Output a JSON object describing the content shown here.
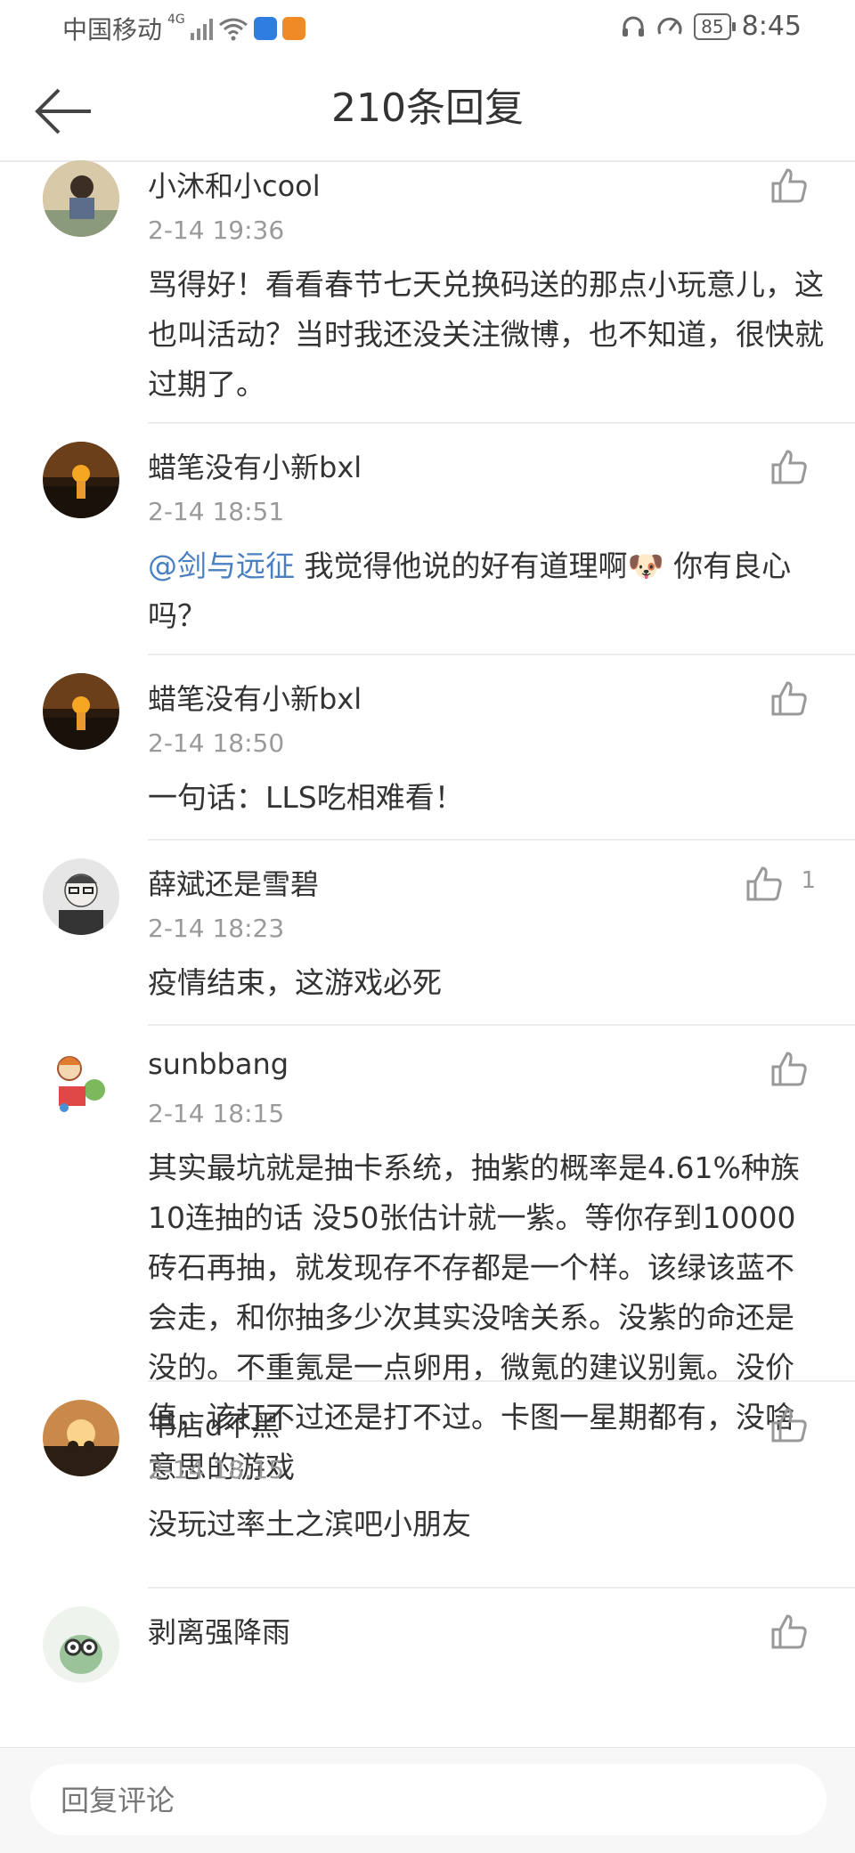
{
  "status_bar": {
    "carrier": "中国移动",
    "network": "4G",
    "battery": "85",
    "time": "8:45"
  },
  "header": {
    "title": "210条回复",
    "back_icon": "arrow-left-icon"
  },
  "comments": [
    {
      "user": "小沐和小cool",
      "time": "2-14 19:36",
      "text": "骂得好！看看春节七天兑换码送的那点小玩意儿，这也叫活动？当时我还没关注微博，也不知道，很快就过期了。",
      "likes": ""
    },
    {
      "user": "蜡笔没有小新bxl",
      "time": "2-14 18:51",
      "mention": "@剑与远征",
      "text": " 我觉得他说的好有道理啊",
      "emoji": "🐶",
      "text2": "  你有良心吗？",
      "likes": ""
    },
    {
      "user": "蜡笔没有小新bxl",
      "time": "2-14 18:50",
      "text": "一句话：LLS吃相难看！",
      "likes": ""
    },
    {
      "user": "薛斌还是雪碧",
      "time": "2-14 18:23",
      "text": "疫情结束，这游戏必死",
      "likes": "1"
    },
    {
      "user": "sunbbang",
      "time": "2-14 18:15",
      "text": "其实最坑就是抽卡系统，抽紫的概率是4.61%种族10连抽的话 没50张估计就一紫。等你存到10000砖石再抽，就发现存不存都是一个样。该绿该蓝不会走，和你抽多少次其实没啥关系。没紫的命还是没的。不重氪是一点卵用，微氪的建议别氪。没价值，该打不过还是打不过。卡图一星期都有，没啥意思的游戏",
      "likes": ""
    },
    {
      "user": "书店d不黑",
      "time": "2-14 18:15",
      "text": "没玩过率土之滨吧小朋友",
      "likes": ""
    },
    {
      "user": "剥离强降雨",
      "time": "",
      "text": "",
      "likes": ""
    }
  ],
  "reply_bar": {
    "placeholder": "回复评论"
  }
}
